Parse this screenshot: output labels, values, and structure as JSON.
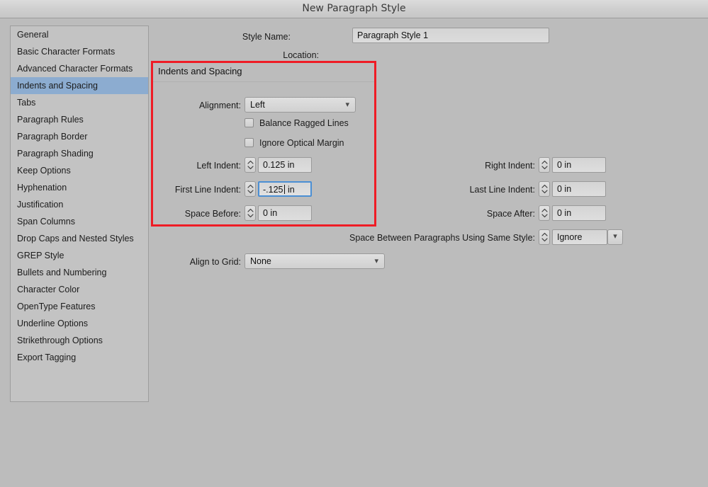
{
  "window": {
    "title": "New Paragraph Style"
  },
  "style_name": {
    "label": "Style Name:",
    "value": "Paragraph Style 1"
  },
  "location": {
    "label": "Location:",
    "value": ""
  },
  "sidebar": {
    "items": [
      {
        "label": "General",
        "selected": false
      },
      {
        "label": "Basic Character Formats",
        "selected": false
      },
      {
        "label": "Advanced Character Formats",
        "selected": false
      },
      {
        "label": "Indents and Spacing",
        "selected": true
      },
      {
        "label": "Tabs",
        "selected": false
      },
      {
        "label": "Paragraph Rules",
        "selected": false
      },
      {
        "label": "Paragraph Border",
        "selected": false
      },
      {
        "label": "Paragraph Shading",
        "selected": false
      },
      {
        "label": "Keep Options",
        "selected": false
      },
      {
        "label": "Hyphenation",
        "selected": false
      },
      {
        "label": "Justification",
        "selected": false
      },
      {
        "label": "Span Columns",
        "selected": false
      },
      {
        "label": "Drop Caps and Nested Styles",
        "selected": false
      },
      {
        "label": "GREP Style",
        "selected": false
      },
      {
        "label": "Bullets and Numbering",
        "selected": false
      },
      {
        "label": "Character Color",
        "selected": false
      },
      {
        "label": "OpenType Features",
        "selected": false
      },
      {
        "label": "Underline Options",
        "selected": false
      },
      {
        "label": "Strikethrough Options",
        "selected": false
      },
      {
        "label": "Export Tagging",
        "selected": false
      }
    ]
  },
  "panel": {
    "title": "Indents and Spacing",
    "alignment": {
      "label": "Alignment:",
      "value": "Left"
    },
    "balance_ragged_lines": {
      "label": "Balance Ragged Lines",
      "checked": false
    },
    "ignore_optical_margin": {
      "label": "Ignore Optical Margin",
      "checked": false
    },
    "left_indent": {
      "label": "Left Indent:",
      "value": "0.125 in"
    },
    "first_line_indent": {
      "label": "First Line Indent:",
      "value_before_caret": "-.125",
      "value_after_caret": " in",
      "focused": true
    },
    "space_before": {
      "label": "Space Before:",
      "value": "0 in"
    },
    "right_indent": {
      "label": "Right Indent:",
      "value": "0 in"
    },
    "last_line_indent": {
      "label": "Last Line Indent:",
      "value": "0 in"
    },
    "space_after": {
      "label": "Space After:",
      "value": "0 in"
    },
    "space_between": {
      "label": "Space Between Paragraphs Using Same Style:",
      "value": "Ignore"
    },
    "align_to_grid": {
      "label": "Align to Grid:",
      "value": "None"
    }
  },
  "annotation": {
    "color": "#ef1c25"
  },
  "colors": {
    "window_background": "#bcbcbc",
    "sidebar_background": "#c3c3c3",
    "selection": "#8cacd0",
    "focus_ring": "#4b8fd4"
  }
}
